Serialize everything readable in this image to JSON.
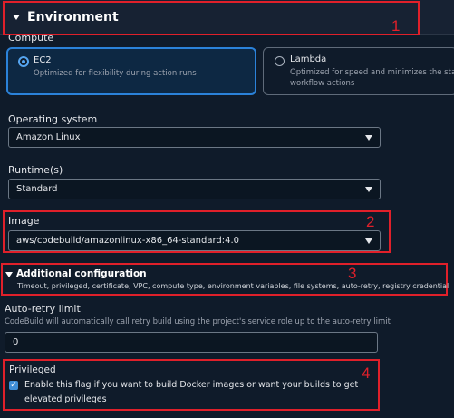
{
  "header": {
    "title": "Environment"
  },
  "compute": {
    "label": "Compute",
    "options": [
      {
        "title": "EC2",
        "desc": "Optimized for flexibility during action runs",
        "desc2": "",
        "selected": true
      },
      {
        "title": "Lambda",
        "desc": "Optimized for speed and minimizes the start u",
        "desc2": "workflow actions",
        "selected": false
      }
    ]
  },
  "os": {
    "label": "Operating system",
    "value": "Amazon Linux"
  },
  "runtime": {
    "label": "Runtime(s)",
    "value": "Standard"
  },
  "image": {
    "label": "Image",
    "value": "aws/codebuild/amazonlinux-x86_64-standard:4.0"
  },
  "additional": {
    "title": "Additional configuration",
    "desc": "Timeout, privileged, certificate, VPC, compute type, environment variables, file systems, auto-retry, registry credential"
  },
  "auto_retry": {
    "label": "Auto-retry limit",
    "desc": "CodeBuild will automatically call retry build using the project's service role up to the auto-retry limit",
    "value": "0"
  },
  "privileged": {
    "label": "Privileged",
    "checkbox_line1": "Enable this flag if you want to build Docker images or want your builds to get",
    "checkbox_line2": "elevated privileges",
    "checked": true
  },
  "annotations": {
    "n1": "1",
    "n2": "2",
    "n3": "3",
    "n4": "4"
  },
  "colors": {
    "annotation_red": "#e0202a",
    "accent_blue": "#2b82d9",
    "background": "#0f1b2a"
  }
}
